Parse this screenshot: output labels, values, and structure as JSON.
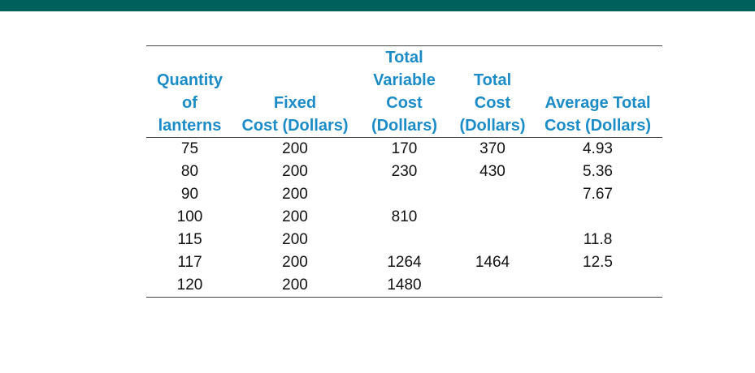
{
  "colors": {
    "top_bar": "#00615a",
    "header_text": "#1b8cc8"
  },
  "table": {
    "headers": [
      [
        "Quantity",
        "of",
        "lanterns"
      ],
      [
        "Fixed",
        "Cost (Dollars)"
      ],
      [
        "Total",
        "Variable",
        "Cost",
        "(Dollars)"
      ],
      [
        "Total",
        "Cost",
        "(Dollars)"
      ],
      [
        "Average Total",
        "Cost (Dollars)"
      ]
    ],
    "rows": [
      [
        "75",
        "200",
        "170",
        "370",
        "4.93"
      ],
      [
        "80",
        "200",
        "230",
        "430",
        "5.36"
      ],
      [
        "90",
        "200",
        "",
        "",
        "7.67"
      ],
      [
        "100",
        "200",
        "810",
        "",
        ""
      ],
      [
        "115",
        "200",
        "",
        "",
        "11.8"
      ],
      [
        "117",
        "200",
        "1264",
        "1464",
        "12.5"
      ],
      [
        "120",
        "200",
        "1480",
        "",
        ""
      ]
    ]
  }
}
